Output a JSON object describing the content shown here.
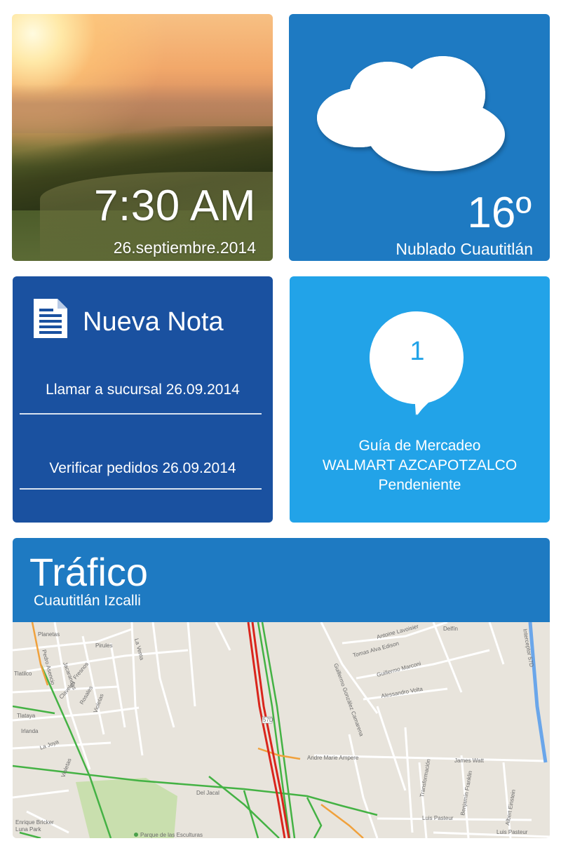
{
  "clock": {
    "time": "7:30 AM",
    "date": "26.septiembre.2014"
  },
  "weather": {
    "temperature": "16º",
    "description": "Nublado Cuautitlán",
    "icon": "cloud-icon"
  },
  "notes": {
    "title": "Nueva Nota",
    "icon": "document-icon",
    "items": [
      {
        "text": "Llamar a sucursal 26.09.2014"
      },
      {
        "text": "Verificar pedidos 26.09.2014"
      }
    ]
  },
  "reminder": {
    "count": "1",
    "icon": "speech-bubble-icon",
    "lines": [
      "Guía de Mercadeo",
      "WALMART AZCAPOTZALCO",
      "Pendeniente"
    ]
  },
  "traffic": {
    "title": "Tráfico",
    "subtitle": "Cuautitlán Izcalli",
    "map_labels": {
      "planetas": "Planetas",
      "pirules": "Pirules",
      "la_venta": "La Venta",
      "pedro_asencio": "Pedro Asencio",
      "jacarandas": "Jacarandas",
      "fresnos": "Fresnos",
      "claveles": "Claveles",
      "rosales": "Rosales",
      "violetas": "Violetas",
      "tlatilco": "Tlatilco",
      "tlataya": "Tlataya",
      "irlanda": "Irlanda",
      "la_joya": "La Joya",
      "del_jacal": "Del Jacal",
      "enrique_bricker": "Enrique Bricker",
      "luna_park": "Luna Park",
      "parque_esculturas": "Parque de las Esculturas",
      "tomas_alva_edison": "Tomas Alva Edison",
      "guillermo_marconi": "Guillermo Marconi",
      "alessandro_volta": "Alessandro Volta",
      "andre_marie_ampere": "Andre Marie Ampere",
      "james_watt": "James Watt",
      "benjamin_franklin": "Benjamín Franklin",
      "albert_einstein": "Albert Einstein",
      "luis_pasteur": "Luis Pasteur",
      "transformacion": "Transformación",
      "delfin": "Delfín",
      "lavoisier": "Antoine Lavoisier",
      "guillermo_gonzalez": "Guillermo González Camarena",
      "highway_shield": "57D",
      "interceptor": "Interceptor 57D"
    }
  }
}
